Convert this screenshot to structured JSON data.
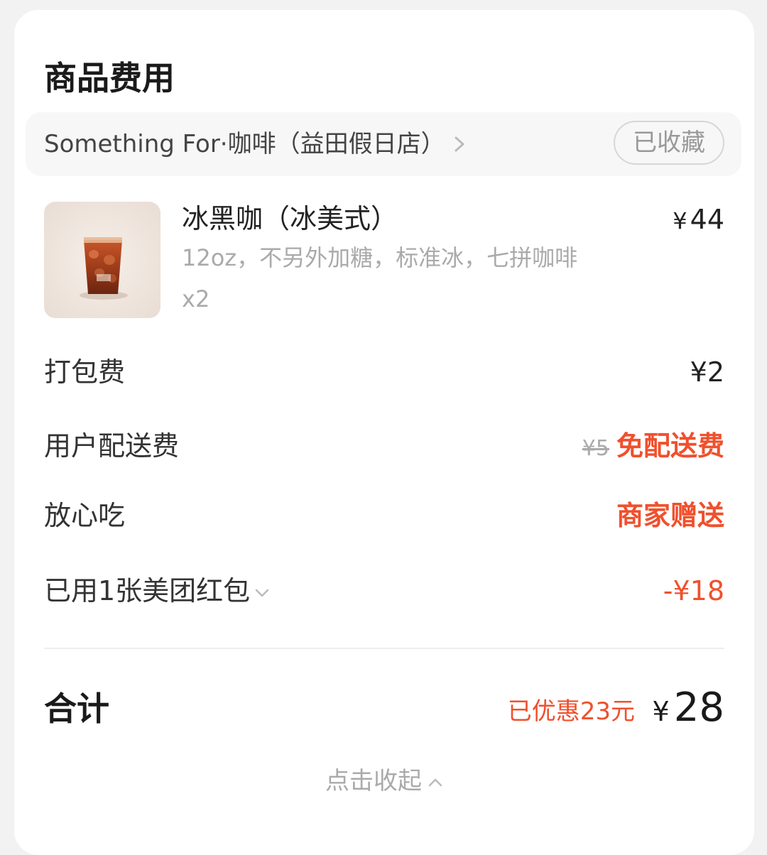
{
  "section": {
    "title": "商品费用"
  },
  "shop": {
    "name": "Something For·咖啡（益田假日店）",
    "favorite_label": "已收藏"
  },
  "product": {
    "name": "冰黑咖（冰美式）",
    "currency": "¥",
    "price": "44",
    "spec": "12oz，不另外加糖，标准冰，七拼咖啡",
    "quantity": "x2"
  },
  "fees": {
    "packaging_label": "打包费",
    "packaging_value": "¥2",
    "delivery_label": "用户配送费",
    "delivery_original": "¥5",
    "delivery_value": "免配送费",
    "assurance_label": "放心吃",
    "assurance_value": "商家赠送",
    "coupon_label": "已用1张美团红包",
    "coupon_value": "-¥18"
  },
  "total": {
    "label": "合计",
    "discount": "已优惠23元",
    "currency": "¥",
    "amount": "28"
  },
  "footer": {
    "collapse_label": "点击收起"
  },
  "colors": {
    "accent_red": "#f0502d",
    "muted_gray": "#aaaaaa"
  },
  "icons": [
    "chevron-right-icon",
    "chevron-down-icon",
    "chevron-up-icon"
  ]
}
